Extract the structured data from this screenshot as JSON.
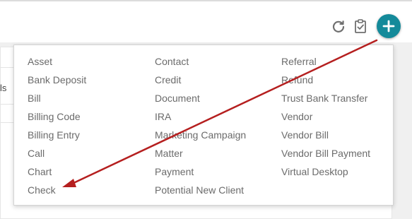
{
  "toolbar": {
    "refresh_icon": "refresh-icon",
    "checklist_icon": "clipboard-check-icon",
    "add_icon": "plus-icon",
    "accent_color": "#148a9a"
  },
  "background": {
    "fragment_text": "ls"
  },
  "menu": {
    "columns": [
      [
        "Asset",
        "Bank Deposit",
        "Bill",
        "Billing Code",
        "Billing Entry",
        "Call",
        "Chart",
        "Check"
      ],
      [
        "Contact",
        "Credit",
        "Document",
        "IRA",
        "Marketing Campaign",
        "Matter",
        "Payment",
        "Potential New Client"
      ],
      [
        "Referral",
        "Refund",
        "Trust Bank Transfer",
        "Vendor",
        "Vendor Bill",
        "Vendor Bill Payment",
        "Virtual Desktop"
      ]
    ]
  },
  "annotation": {
    "arrow_color": "#b51f1f"
  }
}
